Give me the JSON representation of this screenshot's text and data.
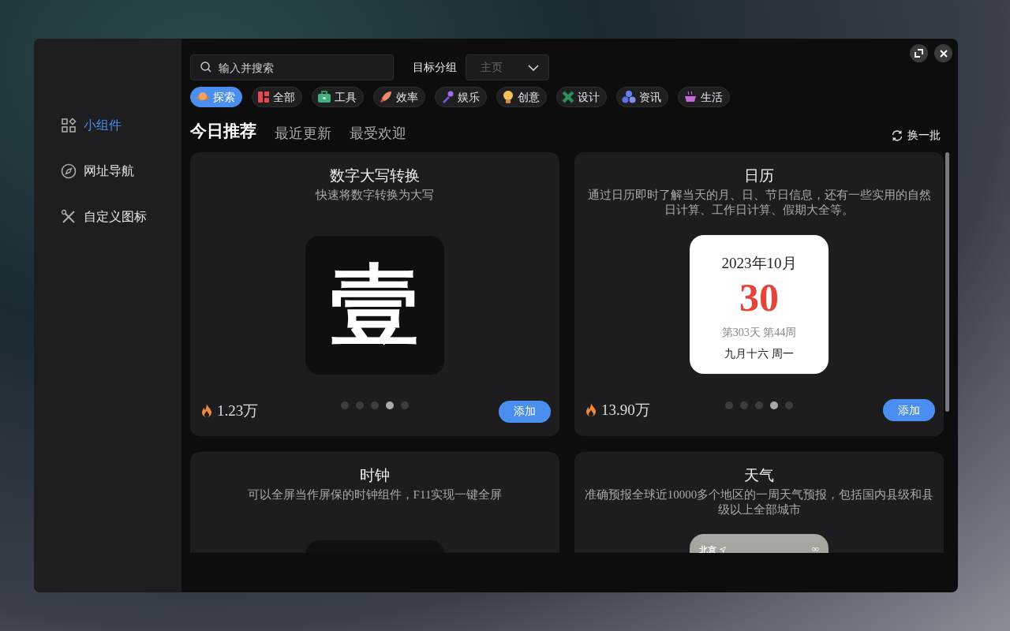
{
  "sidebar": {
    "items": [
      {
        "label": "小组件",
        "selected": true
      },
      {
        "label": "网址导航",
        "selected": false
      },
      {
        "label": "自定义图标",
        "selected": false
      }
    ]
  },
  "search": {
    "placeholder": "输入并搜索"
  },
  "group": {
    "label": "目标分组",
    "value": "主页"
  },
  "categories": [
    {
      "label": "探索",
      "selected": true
    },
    {
      "label": "全部",
      "selected": false
    },
    {
      "label": "工具",
      "selected": false
    },
    {
      "label": "效率",
      "selected": false
    },
    {
      "label": "娱乐",
      "selected": false
    },
    {
      "label": "创意",
      "selected": false
    },
    {
      "label": "设计",
      "selected": false
    },
    {
      "label": "资讯",
      "selected": false
    },
    {
      "label": "生活",
      "selected": false
    }
  ],
  "tabs": [
    {
      "label": "今日推荐",
      "selected": true
    },
    {
      "label": "最近更新",
      "selected": false
    },
    {
      "label": "最受欢迎",
      "selected": false
    }
  ],
  "refresh": "换一批",
  "cards": [
    {
      "title": "数字大写转换",
      "description": "快速将数字转换为大写",
      "kind": "big-char",
      "preview": {
        "char": "壹"
      },
      "dots": [
        {
          "selected": false
        },
        {
          "selected": false
        },
        {
          "selected": false
        },
        {
          "selected": true
        },
        {
          "selected": false
        }
      ],
      "count": "1.23万",
      "button": "添加"
    },
    {
      "title": "日历",
      "description": "通过日历即时了解当天的月、日、节日信息，还有一些实用的自然日计算、工作日计算、假期大全等。",
      "kind": "calendar",
      "preview": {
        "month": "2023年10月",
        "day": "30",
        "info": "第303天 第44周",
        "lunar": "九月十六 周一"
      },
      "dots": [
        {
          "selected": false
        },
        {
          "selected": false
        },
        {
          "selected": false
        },
        {
          "selected": true
        },
        {
          "selected": false
        }
      ],
      "count": "13.90万",
      "button": "添加"
    },
    {
      "title": "时钟",
      "description": "可以全屏当作屏保的时钟组件，F11实现一键全屏",
      "kind": "clock"
    },
    {
      "title": "天气",
      "description": "准确预报全球近10000多个地区的一周天气预报，包括国内县级和县级以上全部城市",
      "kind": "weather",
      "preview": {
        "city": "北京",
        "mark": "∞"
      }
    }
  ]
}
